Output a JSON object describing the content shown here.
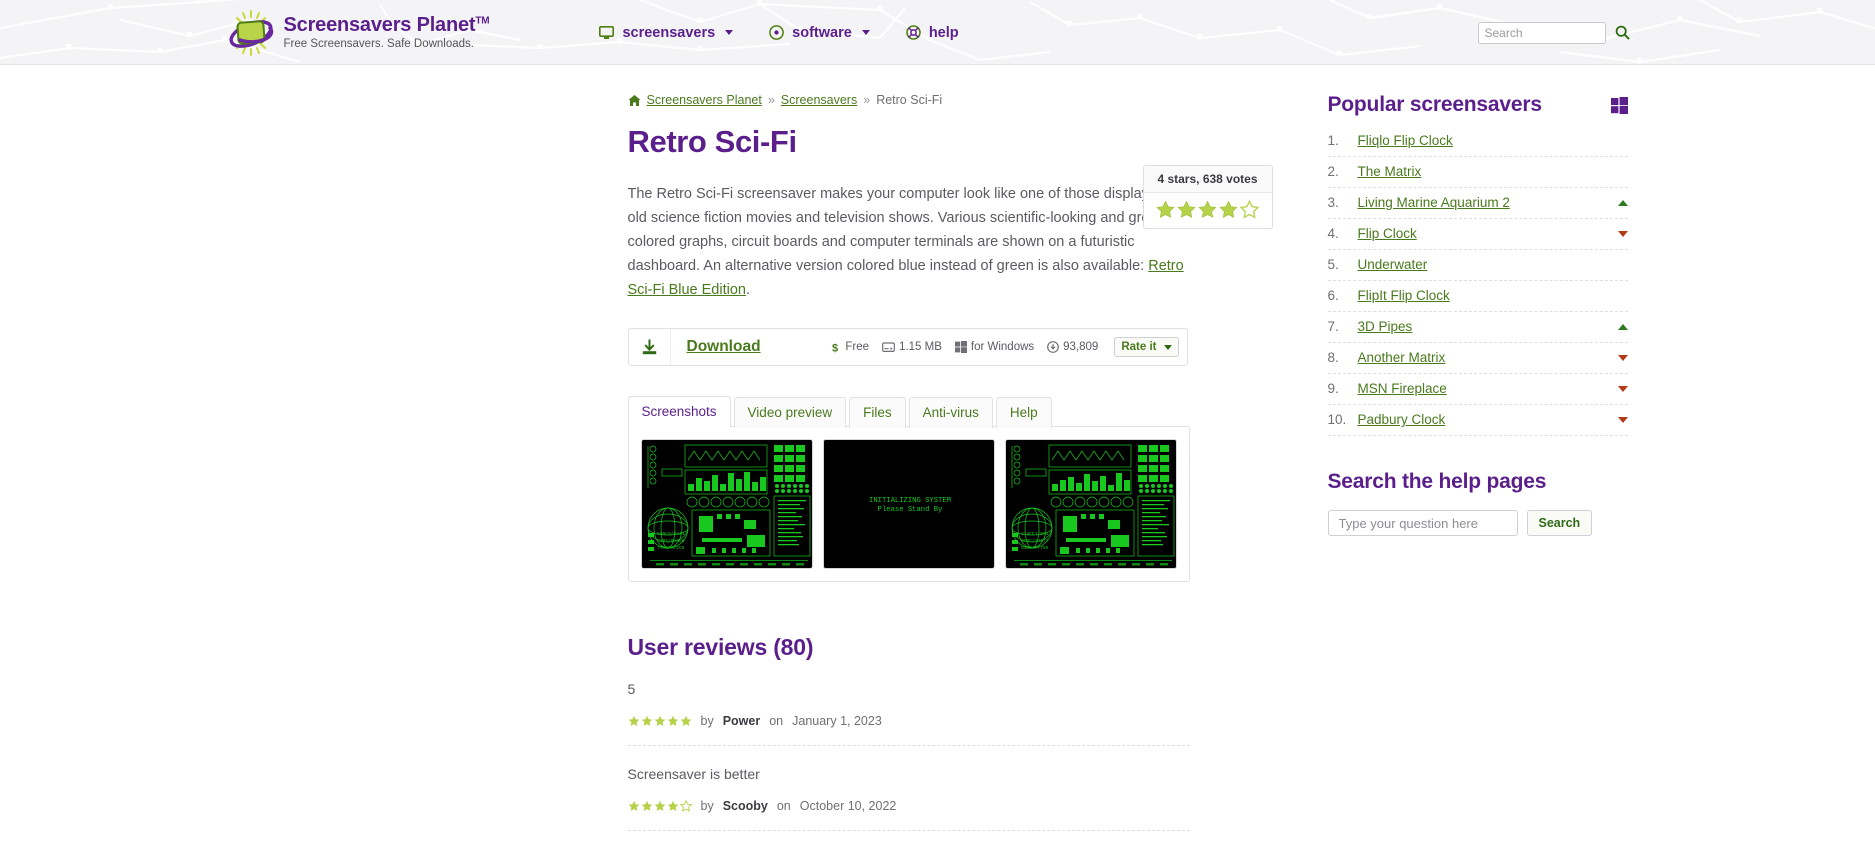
{
  "header": {
    "brand_title": "Screensavers Planet",
    "brand_tm": "TM",
    "brand_tagline": "Free Screensavers. Safe Downloads.",
    "logo_icon": "planet-screen-logo",
    "nav": [
      {
        "label": "screensavers",
        "icon": "monitor-icon",
        "has_caret": true
      },
      {
        "label": "software",
        "icon": "disc-icon",
        "has_caret": true
      },
      {
        "label": "help",
        "icon": "lifebuoy-icon",
        "has_caret": false
      }
    ],
    "search": {
      "placeholder": "Search",
      "value": "",
      "button_icon": "magnifier-icon"
    }
  },
  "breadcrumb": {
    "home_icon": "home-icon",
    "items": [
      {
        "label": "Screensavers Planet",
        "link": true
      },
      {
        "label": "Screensavers",
        "link": true
      },
      {
        "label": "Retro Sci-Fi",
        "link": false
      }
    ],
    "separator": "»"
  },
  "page": {
    "title": "Retro Sci-Fi",
    "description_part1": "The Retro Sci-Fi screensaver makes your computer look like one of those displays in old science fiction movies and television shows. Various scientific-looking and green-colored graphs, circuit boards and computer terminals are shown on a futuristic dashboard. An alternative version colored blue instead of green is also available: ",
    "description_link": "Retro Sci-Fi Blue Edition",
    "description_end": "."
  },
  "rating": {
    "summary": "4 stars, 638 votes",
    "filled": 4,
    "total": 5,
    "star_color": "#b0d martinez",
    "star_fill": "#b5d24a",
    "star_empty_stroke": "#b5d24a"
  },
  "download": {
    "icon": "download-icon",
    "link_label": "Download",
    "meta": [
      {
        "icon": "dollar-icon",
        "label": "Free"
      },
      {
        "icon": "harddisk-icon",
        "label": "1.15 MB"
      },
      {
        "icon": "windows-icon",
        "label": "for Windows"
      },
      {
        "icon": "download-count-icon",
        "label": "93,809"
      }
    ],
    "rate_button": "Rate it"
  },
  "tabs": {
    "items": [
      {
        "label": "Screenshots",
        "active": true
      },
      {
        "label": "Video preview",
        "active": false
      },
      {
        "label": "Files",
        "active": false
      },
      {
        "label": "Anti-virus",
        "active": false
      },
      {
        "label": "Help",
        "active": false
      }
    ]
  },
  "screenshots": [
    {
      "name": "retro-dashboard-left",
      "type": "dashboard"
    },
    {
      "name": "initializing-system",
      "type": "boot",
      "line1": "INITIALIZING SYSTEM",
      "line2": "Please Stand By"
    },
    {
      "name": "retro-dashboard-right",
      "type": "dashboard"
    }
  ],
  "reviews": {
    "heading": "User reviews (80)",
    "items": [
      {
        "text": "5",
        "stars": 5,
        "by_prefix": "by",
        "author": "Power",
        "on_prefix": "on",
        "date": "January 1, 2023"
      },
      {
        "text": "Screensaver is better",
        "stars": 4,
        "by_prefix": "by",
        "author": "Scooby",
        "on_prefix": "on",
        "date": "October 10, 2022"
      }
    ]
  },
  "sidebar": {
    "popular_title": "Popular screensavers",
    "platform_icon": "windows-icon",
    "popular_items": [
      {
        "rank": "1.",
        "label": "Fliqlo Flip Clock",
        "trend": "none"
      },
      {
        "rank": "2.",
        "label": "The Matrix",
        "trend": "none"
      },
      {
        "rank": "3.",
        "label": "Living Marine Aquarium 2",
        "trend": "up"
      },
      {
        "rank": "4.",
        "label": "Flip Clock",
        "trend": "down"
      },
      {
        "rank": "5.",
        "label": "Underwater",
        "trend": "none"
      },
      {
        "rank": "6.",
        "label": "FlipIt Flip Clock",
        "trend": "none"
      },
      {
        "rank": "7.",
        "label": "3D Pipes",
        "trend": "up"
      },
      {
        "rank": "8.",
        "label": "Another Matrix",
        "trend": "down"
      },
      {
        "rank": "9.",
        "label": "MSN Fireplace",
        "trend": "down"
      },
      {
        "rank": "10.",
        "label": "Padbury Clock",
        "trend": "down"
      }
    ],
    "help_title": "Search the help pages",
    "help_placeholder": "Type your question here",
    "help_value": "",
    "help_input_icon": "keyboard-icon",
    "help_button": "Search"
  },
  "colors": {
    "brand_purple": "#5b1f8c",
    "link_green": "#4a7a1e",
    "star_green": "#b5d24a",
    "header_bg": "#f4f4f6",
    "trend_up": "#2f7a1e",
    "trend_down": "#b53a16"
  }
}
